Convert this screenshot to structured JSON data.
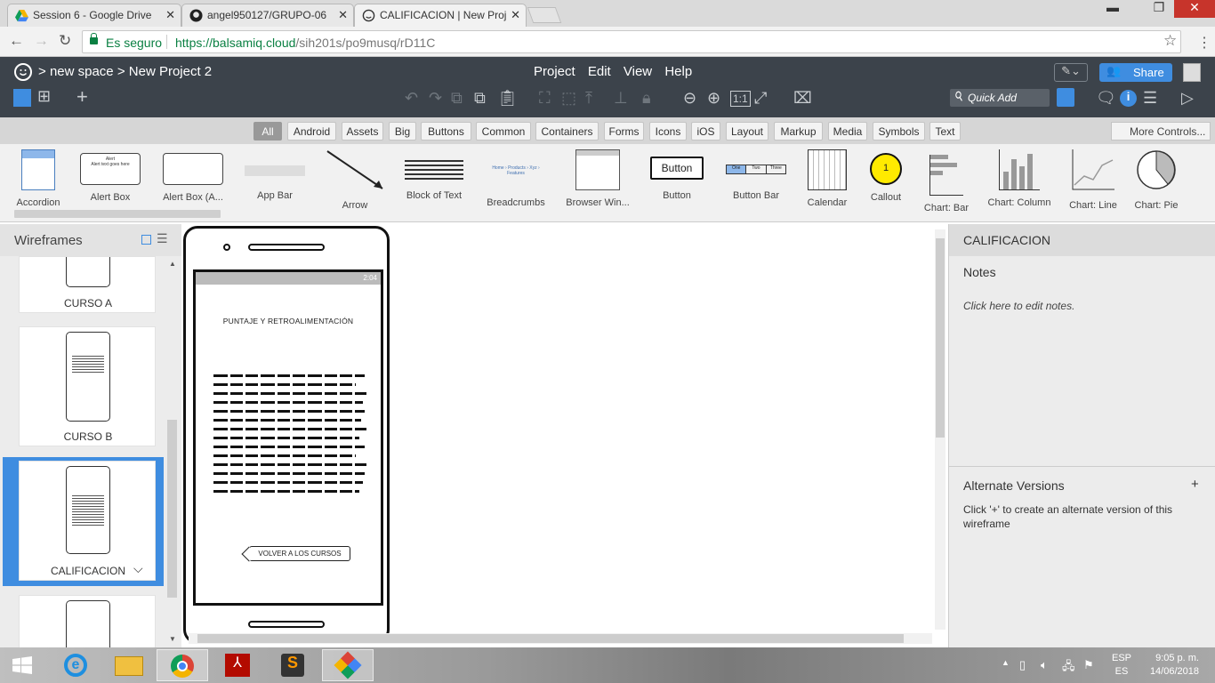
{
  "browser": {
    "tabs": [
      {
        "title": "Session 6 - Google Drive",
        "icon": "google-drive-icon"
      },
      {
        "title": "angel950127/GRUPO-06",
        "icon": "github-icon"
      },
      {
        "title": "CALIFICACION | New Proj",
        "icon": "balsamiq-icon"
      }
    ],
    "close_glyph": "✕",
    "secure_label": "Es seguro",
    "url_host": "https://balsamiq.cloud",
    "url_path": "/sih201s/po9musq/rD11C",
    "star": "☆",
    "kebab": "⋮",
    "window_min": "▬",
    "window_max": "❐",
    "window_close": "✕"
  },
  "app": {
    "breadcrumb_sep": ">",
    "space": "new space",
    "project": "New Project 2",
    "menus": [
      "Project",
      "Edit",
      "View",
      "Help"
    ],
    "share_label": "Share",
    "quick_add_placeholder": "Quick Add",
    "info_glyph": "i"
  },
  "categories": [
    "All",
    "Android",
    "Assets",
    "Big",
    "Buttons",
    "Common",
    "Containers",
    "Forms",
    "Icons",
    "iOS",
    "Layout",
    "Markup",
    "Media",
    "Symbols",
    "Text"
  ],
  "selected_category": "All",
  "more_controls": "More Controls...",
  "controls": [
    "Accordion",
    "Alert Box",
    "Alert Box (A...",
    "App Bar",
    "Arrow",
    "Block of Text",
    "Breadcrumbs",
    "Browser Win...",
    "Button",
    "Button Bar",
    "Calendar",
    "Callout",
    "Chart: Bar",
    "Chart: Column",
    "Chart: Line",
    "Chart: Pie"
  ],
  "control_previews": {
    "button_text": "Button",
    "buttonbar": [
      "One",
      "Two",
      "Three"
    ],
    "callout_num": "1",
    "alert_title": "Alert",
    "alert_text": "Alert text goes here",
    "alert_no": "No",
    "alert_yes": "Yes",
    "breadcrumb_text": "Home › Products › Xyz › Features"
  },
  "wireframes": {
    "title": "Wireframes",
    "items": [
      "CURSO A",
      "CURSO B",
      "CALIFICACION"
    ],
    "selected": "CALIFICACION",
    "chevron": "⌵"
  },
  "canvas": {
    "status_time": "2:04",
    "page_title": "PUNTAJE Y RETROALIMENTACIÓN",
    "back_button": "VOLVER A LOS CURSOS"
  },
  "inspector": {
    "title": "CALIFICACION",
    "notes_heading": "Notes",
    "notes_placeholder": "Click here to edit notes.",
    "alt_heading": "Alternate Versions",
    "alt_plus": "+",
    "alt_desc": "Click '+' to create an alternate version of this wireframe"
  },
  "taskbar": {
    "lang_top": "ESP",
    "lang_bottom": "ES",
    "time": "9:05 p. m.",
    "date": "14/06/2018"
  }
}
